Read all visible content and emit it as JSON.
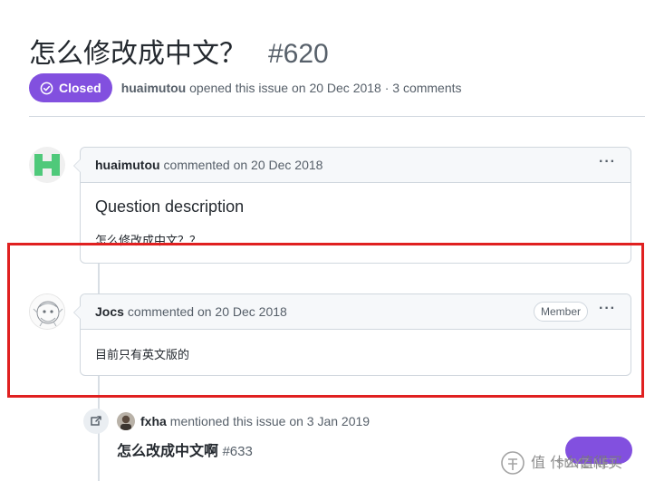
{
  "issue": {
    "title": "怎么修改成中文？",
    "number": "#620",
    "state": "Closed",
    "author": "huaimutou",
    "meta_suffix": "opened this issue on 20 Dec 2018 · 3 comments"
  },
  "comments": [
    {
      "author": "huaimutou",
      "meta": "commented on 20 Dec 2018",
      "heading": "Question description",
      "body": "怎么修改成中文？？"
    },
    {
      "author": "Jocs",
      "meta": "commented on 20 Dec 2018",
      "role": "Member",
      "body": "目前只有英文版的"
    }
  ],
  "mention_event": {
    "actor": "fxha",
    "text": "mentioned this issue on 3 Jan 2019",
    "ref_title": "怎么改成中文啊",
    "ref_number": "#633"
  },
  "menu_glyph": "···",
  "watermark": {
    "text": "值 什么值得买",
    "sub": "SMYZ.NET"
  },
  "colors": {
    "closed_purple": "#8250df",
    "highlight_red": "#e02020",
    "identicon_green": "#4fc97a"
  }
}
